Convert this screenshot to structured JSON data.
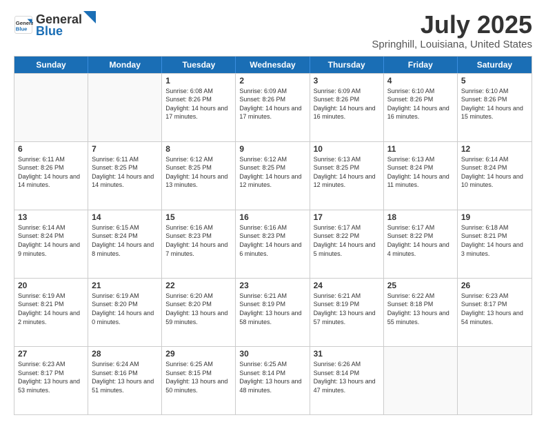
{
  "logo": {
    "general": "General",
    "blue": "Blue"
  },
  "title": "July 2025",
  "subtitle": "Springhill, Louisiana, United States",
  "header_days": [
    "Sunday",
    "Monday",
    "Tuesday",
    "Wednesday",
    "Thursday",
    "Friday",
    "Saturday"
  ],
  "weeks": [
    [
      {
        "day": "",
        "info": ""
      },
      {
        "day": "",
        "info": ""
      },
      {
        "day": "1",
        "info": "Sunrise: 6:08 AM\nSunset: 8:26 PM\nDaylight: 14 hours and 17 minutes."
      },
      {
        "day": "2",
        "info": "Sunrise: 6:09 AM\nSunset: 8:26 PM\nDaylight: 14 hours and 17 minutes."
      },
      {
        "day": "3",
        "info": "Sunrise: 6:09 AM\nSunset: 8:26 PM\nDaylight: 14 hours and 16 minutes."
      },
      {
        "day": "4",
        "info": "Sunrise: 6:10 AM\nSunset: 8:26 PM\nDaylight: 14 hours and 16 minutes."
      },
      {
        "day": "5",
        "info": "Sunrise: 6:10 AM\nSunset: 8:26 PM\nDaylight: 14 hours and 15 minutes."
      }
    ],
    [
      {
        "day": "6",
        "info": "Sunrise: 6:11 AM\nSunset: 8:26 PM\nDaylight: 14 hours and 14 minutes."
      },
      {
        "day": "7",
        "info": "Sunrise: 6:11 AM\nSunset: 8:25 PM\nDaylight: 14 hours and 14 minutes."
      },
      {
        "day": "8",
        "info": "Sunrise: 6:12 AM\nSunset: 8:25 PM\nDaylight: 14 hours and 13 minutes."
      },
      {
        "day": "9",
        "info": "Sunrise: 6:12 AM\nSunset: 8:25 PM\nDaylight: 14 hours and 12 minutes."
      },
      {
        "day": "10",
        "info": "Sunrise: 6:13 AM\nSunset: 8:25 PM\nDaylight: 14 hours and 12 minutes."
      },
      {
        "day": "11",
        "info": "Sunrise: 6:13 AM\nSunset: 8:24 PM\nDaylight: 14 hours and 11 minutes."
      },
      {
        "day": "12",
        "info": "Sunrise: 6:14 AM\nSunset: 8:24 PM\nDaylight: 14 hours and 10 minutes."
      }
    ],
    [
      {
        "day": "13",
        "info": "Sunrise: 6:14 AM\nSunset: 8:24 PM\nDaylight: 14 hours and 9 minutes."
      },
      {
        "day": "14",
        "info": "Sunrise: 6:15 AM\nSunset: 8:24 PM\nDaylight: 14 hours and 8 minutes."
      },
      {
        "day": "15",
        "info": "Sunrise: 6:16 AM\nSunset: 8:23 PM\nDaylight: 14 hours and 7 minutes."
      },
      {
        "day": "16",
        "info": "Sunrise: 6:16 AM\nSunset: 8:23 PM\nDaylight: 14 hours and 6 minutes."
      },
      {
        "day": "17",
        "info": "Sunrise: 6:17 AM\nSunset: 8:22 PM\nDaylight: 14 hours and 5 minutes."
      },
      {
        "day": "18",
        "info": "Sunrise: 6:17 AM\nSunset: 8:22 PM\nDaylight: 14 hours and 4 minutes."
      },
      {
        "day": "19",
        "info": "Sunrise: 6:18 AM\nSunset: 8:21 PM\nDaylight: 14 hours and 3 minutes."
      }
    ],
    [
      {
        "day": "20",
        "info": "Sunrise: 6:19 AM\nSunset: 8:21 PM\nDaylight: 14 hours and 2 minutes."
      },
      {
        "day": "21",
        "info": "Sunrise: 6:19 AM\nSunset: 8:20 PM\nDaylight: 14 hours and 0 minutes."
      },
      {
        "day": "22",
        "info": "Sunrise: 6:20 AM\nSunset: 8:20 PM\nDaylight: 13 hours and 59 minutes."
      },
      {
        "day": "23",
        "info": "Sunrise: 6:21 AM\nSunset: 8:19 PM\nDaylight: 13 hours and 58 minutes."
      },
      {
        "day": "24",
        "info": "Sunrise: 6:21 AM\nSunset: 8:19 PM\nDaylight: 13 hours and 57 minutes."
      },
      {
        "day": "25",
        "info": "Sunrise: 6:22 AM\nSunset: 8:18 PM\nDaylight: 13 hours and 55 minutes."
      },
      {
        "day": "26",
        "info": "Sunrise: 6:23 AM\nSunset: 8:17 PM\nDaylight: 13 hours and 54 minutes."
      }
    ],
    [
      {
        "day": "27",
        "info": "Sunrise: 6:23 AM\nSunset: 8:17 PM\nDaylight: 13 hours and 53 minutes."
      },
      {
        "day": "28",
        "info": "Sunrise: 6:24 AM\nSunset: 8:16 PM\nDaylight: 13 hours and 51 minutes."
      },
      {
        "day": "29",
        "info": "Sunrise: 6:25 AM\nSunset: 8:15 PM\nDaylight: 13 hours and 50 minutes."
      },
      {
        "day": "30",
        "info": "Sunrise: 6:25 AM\nSunset: 8:14 PM\nDaylight: 13 hours and 48 minutes."
      },
      {
        "day": "31",
        "info": "Sunrise: 6:26 AM\nSunset: 8:14 PM\nDaylight: 13 hours and 47 minutes."
      },
      {
        "day": "",
        "info": ""
      },
      {
        "day": "",
        "info": ""
      }
    ]
  ]
}
